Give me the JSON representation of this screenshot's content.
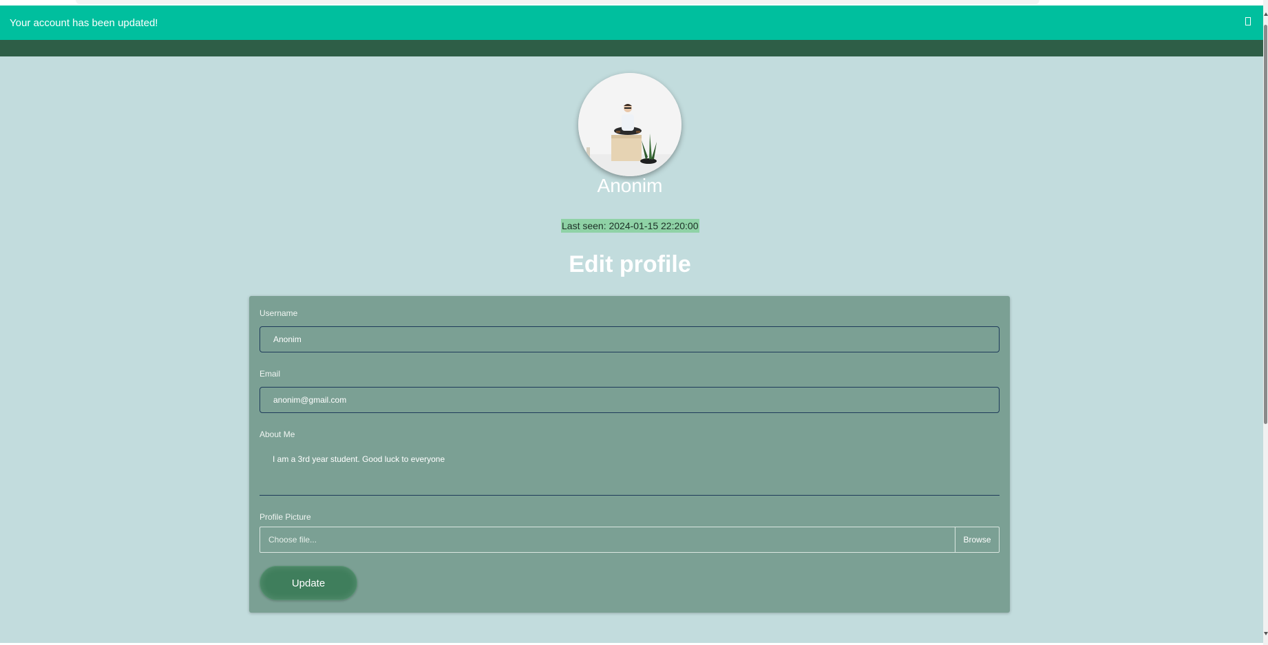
{
  "alert": {
    "message": "Your account has been updated!"
  },
  "profile": {
    "username": "Anonim",
    "last_seen": "Last seen: 2024-01-15 22:20:00"
  },
  "page_title": "Edit profile",
  "form": {
    "username_label": "Username",
    "username_value": "Anonim",
    "email_label": "Email",
    "email_value": "anonim@gmail.com",
    "about_label": "About Me",
    "about_value": "I am a 3rd year student. Good luck to everyone",
    "picture_label": "Profile Picture",
    "file_placeholder": "Choose file...",
    "browse_label": "Browse",
    "submit_label": "Update"
  },
  "colors": {
    "alert_bg": "#00bf9e",
    "navbar_bg": "#2e5e47",
    "page_bg": "#c2dcdd",
    "card_bg": "#7ba094",
    "button_bg": "#3f7e5c"
  }
}
